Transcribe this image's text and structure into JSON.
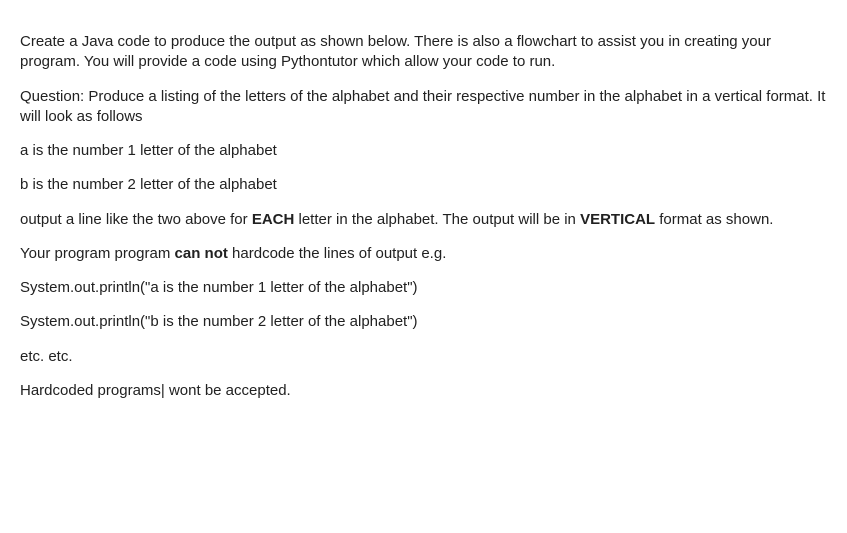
{
  "paragraphs": {
    "intro": "Create a Java code to produce the output as shown below. There is also a flowchart to assist you in creating your program. You will provide a code using Pythontutor which allow your code to run.",
    "question": "Question: Produce a listing of the letters of the alphabet and their respective number in the alphabet in a vertical format. It will look as follows",
    "example_a": "a is the number 1 letter of the alphabet",
    "example_b": "b is the number 2 letter of the alphabet",
    "each_prefix": "output a line like the two above for ",
    "each_bold": "EACH",
    "each_mid": " letter in the alphabet. The output will be in ",
    "vertical_bold": "VERTICAL",
    "each_suffix": " format as shown.",
    "cannot_prefix": "Your program program ",
    "cannot_bold": "can not",
    "cannot_suffix": " hardcode the lines of output e.g.",
    "sysout_a": "System.out.println(\"a is the number 1 letter of the alphabet\")",
    "sysout_b": "System.out.println(\"b is the number 2 letter of the alphabet\")",
    "etc": "etc. etc.",
    "hardcoded": "Hardcoded programs| wont be accepted."
  }
}
